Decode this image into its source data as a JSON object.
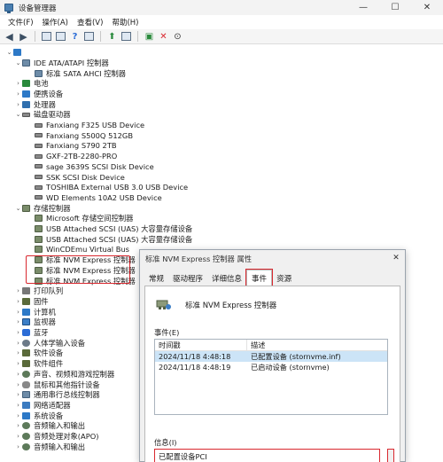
{
  "window": {
    "title": "设备管理器",
    "minimize": "—",
    "maximize": "☐",
    "close": "✕"
  },
  "menu": [
    "文件(F)",
    "操作(A)",
    "查看(V)",
    "帮助(H)"
  ],
  "tree": [
    {
      "label": "IDE ATA/ATAPI 控制器",
      "level": 1,
      "chev": "⌄",
      "icon": "i-ctrl"
    },
    {
      "label": "标准 SATA AHCI 控制器",
      "level": 2,
      "chev": "",
      "icon": "i-ctrl"
    },
    {
      "label": "电池",
      "level": 1,
      "chev": "›",
      "icon": "i-green"
    },
    {
      "label": "便携设备",
      "level": 1,
      "chev": "›",
      "icon": "i-pc"
    },
    {
      "label": "处理器",
      "level": 1,
      "chev": "›",
      "icon": "i-cpu"
    },
    {
      "label": "磁盘驱动器",
      "level": 1,
      "chev": "⌄",
      "icon": "i-disk"
    },
    {
      "label": "Fanxiang F325 USB Device",
      "level": 2,
      "chev": "",
      "icon": "i-disk"
    },
    {
      "label": "Fanxiang S500Q 512GB",
      "level": 2,
      "chev": "",
      "icon": "i-disk"
    },
    {
      "label": "Fanxiang S790 2TB",
      "level": 2,
      "chev": "",
      "icon": "i-disk"
    },
    {
      "label": "GXF-2TB-2280-PRO",
      "level": 2,
      "chev": "",
      "icon": "i-disk"
    },
    {
      "label": "sage 3639S SCSI Disk Device",
      "level": 2,
      "chev": "",
      "icon": "i-disk"
    },
    {
      "label": "SSK  SCSI Disk Device",
      "level": 2,
      "chev": "",
      "icon": "i-disk"
    },
    {
      "label": "TOSHIBA External USB 3.0 USB Device",
      "level": 2,
      "chev": "",
      "icon": "i-disk"
    },
    {
      "label": "WD Elements 10A2 USB Device",
      "level": 2,
      "chev": "",
      "icon": "i-disk"
    },
    {
      "label": "存储控制器",
      "level": 1,
      "chev": "⌄",
      "icon": "i-stor"
    },
    {
      "label": "Microsoft 存储空间控制器",
      "level": 2,
      "chev": "",
      "icon": "i-stor"
    },
    {
      "label": "USB Attached SCSI (UAS) 大容量存储设备",
      "level": 2,
      "chev": "",
      "icon": "i-stor"
    },
    {
      "label": "USB Attached SCSI (UAS) 大容量存储设备",
      "level": 2,
      "chev": "",
      "icon": "i-stor"
    },
    {
      "label": "WinCDEmu Virtual Bus",
      "level": 2,
      "chev": "",
      "icon": "i-stor"
    },
    {
      "label": "标准 NVM Express 控制器",
      "level": 2,
      "chev": "",
      "icon": "i-stor"
    },
    {
      "label": "标准 NVM Express 控制器",
      "level": 2,
      "chev": "",
      "icon": "i-stor"
    },
    {
      "label": "标准 NVM Express 控制器",
      "level": 2,
      "chev": "",
      "icon": "i-stor"
    },
    {
      "label": "打印队列",
      "level": 1,
      "chev": "›",
      "icon": "i-print"
    },
    {
      "label": "固件",
      "level": 1,
      "chev": "›",
      "icon": "i-chip"
    },
    {
      "label": "计算机",
      "level": 1,
      "chev": "›",
      "icon": "i-pc"
    },
    {
      "label": "监视器",
      "level": 1,
      "chev": "›",
      "icon": "i-mon"
    },
    {
      "label": "蓝牙",
      "level": 1,
      "chev": "›",
      "icon": "i-bt"
    },
    {
      "label": "人体学输入设备",
      "level": 1,
      "chev": "›",
      "icon": "i-gear"
    },
    {
      "label": "软件设备",
      "level": 1,
      "chev": "›",
      "icon": "i-chip"
    },
    {
      "label": "软件组件",
      "level": 1,
      "chev": "›",
      "icon": "i-chip"
    },
    {
      "label": "声音、视频和游戏控制器",
      "level": 1,
      "chev": "›",
      "icon": "i-audio"
    },
    {
      "label": "鼠标和其他指针设备",
      "level": 1,
      "chev": "›",
      "icon": "i-mouse"
    },
    {
      "label": "通用串行总线控制器",
      "level": 1,
      "chev": "›",
      "icon": "i-ctrl"
    },
    {
      "label": "网络适配器",
      "level": 1,
      "chev": "›",
      "icon": "i-net"
    },
    {
      "label": "系统设备",
      "level": 1,
      "chev": "›",
      "icon": "i-pc"
    },
    {
      "label": "音频输入和输出",
      "level": 1,
      "chev": "›",
      "icon": "i-audio"
    },
    {
      "label": "音频处理对象(APO)",
      "level": 1,
      "chev": "›",
      "icon": "i-audio"
    },
    {
      "label": "音频输入和输出",
      "level": 1,
      "chev": "›",
      "icon": "i-audio"
    }
  ],
  "dialog": {
    "title": "标准 NVM Express 控制器 属性",
    "close": "✕",
    "tabs": [
      "常规",
      "驱动程序",
      "详细信息",
      "事件",
      "资源"
    ],
    "active_tab": 3,
    "device_name": "标准 NVM Express 控制器",
    "events_label": "事件(E)",
    "columns": [
      "时间戳",
      "描述"
    ],
    "events": [
      {
        "time": "2024/11/18 4:48:18",
        "desc": "已配置设备 (stornvme.inf)"
      },
      {
        "time": "2024/11/18 4:48:19",
        "desc": "已启动设备 (stornvme)"
      }
    ],
    "info_label": "信息(I)",
    "info_text": "已配置设备PCI"
  },
  "colors": {
    "accent_red": "#d9282f",
    "selection": "#cce4f7"
  }
}
